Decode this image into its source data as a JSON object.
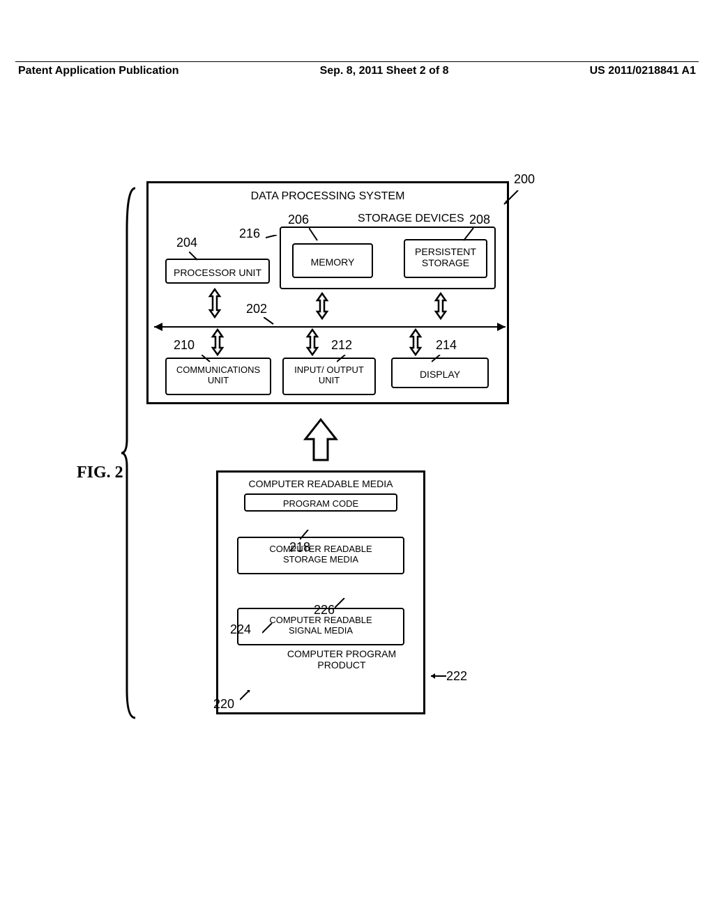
{
  "header": {
    "left": "Patent Application Publication",
    "center": "Sep. 8, 2011   Sheet 2 of 8",
    "right": "US 2011/0218841 A1"
  },
  "figure_label": "FIG. 2",
  "refs": {
    "r200": "200",
    "r202": "202",
    "r204": "204",
    "r206": "206",
    "r208": "208",
    "r210": "210",
    "r212": "212",
    "r214": "214",
    "r216": "216",
    "r218": "218",
    "r220": "220",
    "r222": "222",
    "r224": "224",
    "r226": "226"
  },
  "labels": {
    "dps": "DATA PROCESSING SYSTEM",
    "storage_devices": "STORAGE DEVICES",
    "processor_unit": "PROCESSOR UNIT",
    "memory": "MEMORY",
    "persistent_storage_l1": "PERSISTENT",
    "persistent_storage_l2": "STORAGE",
    "comm_l1": "COMMUNICATIONS",
    "comm_l2": "UNIT",
    "io_l1": "INPUT/ OUTPUT",
    "io_l2": "UNIT",
    "display": "DISPLAY",
    "crm": "COMPUTER READABLE MEDIA",
    "program_code": "PROGRAM CODE",
    "crsm_l1": "COMPUTER READABLE",
    "crsm_l2": "STORAGE MEDIA",
    "crsig_l1": "COMPUTER READABLE",
    "crsig_l2": "SIGNAL MEDIA",
    "cpp_l1": "COMPUTER PROGRAM",
    "cpp_l2": "PRODUCT"
  }
}
